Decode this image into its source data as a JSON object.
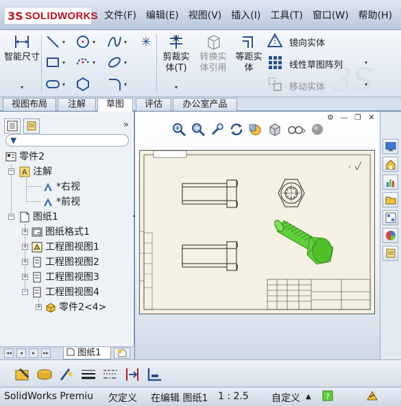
{
  "app": {
    "logo_text": "SOLIDWORKS",
    "logo_mark": "3S",
    "watermark": "3S"
  },
  "menu": [
    "文件(F)",
    "编辑(E)",
    "视图(V)",
    "插入(I)",
    "工具(T)",
    "窗口(W)",
    "帮助(H)"
  ],
  "ribbon": {
    "smart_dimension": "智能尺寸",
    "trim_entities": "剪裁实体(T)",
    "convert_entities": "转换实体引用",
    "offset_entities": "等距实体",
    "mirror_entities": "镜向实体",
    "linear_pattern": "线性草图阵列",
    "move_entities": "移动实体",
    "star_symbol": "✳"
  },
  "tabs": [
    "视图布局",
    "注解",
    "草图",
    "评估",
    "办公室产品"
  ],
  "active_tab": "草图",
  "tree": {
    "root": "零件2",
    "annotations": "注解",
    "annotation_items": [
      "*右视",
      "*前视"
    ],
    "sheet": "图纸1",
    "sheet_items": [
      "图纸格式1",
      "工程图视图1",
      "工程图视图2",
      "工程图视图3",
      "工程图视图4"
    ],
    "part_ref": "零件2<4>"
  },
  "sheet_tab": "图纸1",
  "panel_more": "»",
  "status": {
    "product": "SolidWorks Premiu",
    "definition": "欠定义",
    "editing": "在编辑 图纸1",
    "scale": "1 : 2.5",
    "custom": "自定义"
  },
  "colors": {
    "accent_red": "#c2121c",
    "part_green": "#5fcf3a",
    "ribbon_blue": "#2b4f8c"
  }
}
